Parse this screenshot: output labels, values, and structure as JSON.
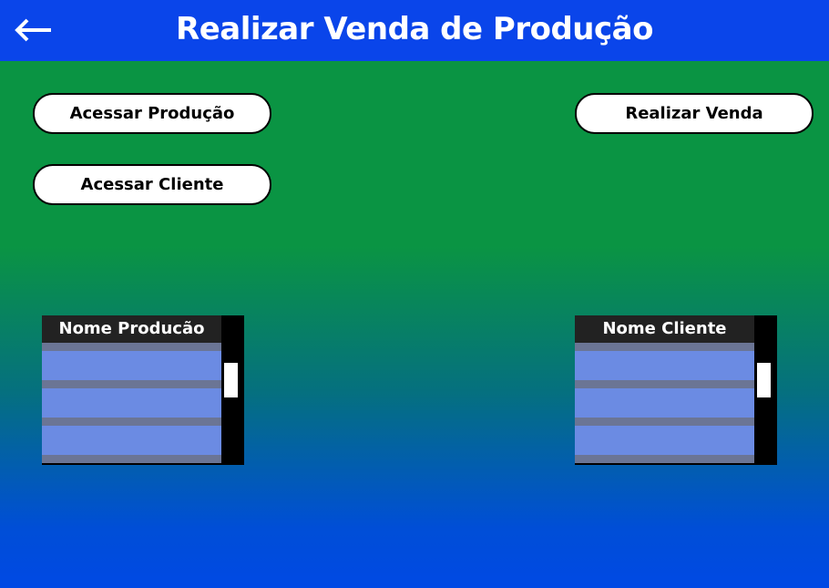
{
  "header": {
    "title": "Realizar Venda de Produção",
    "back_icon": "arrow-left-icon"
  },
  "buttons": {
    "acessar_producao": "Acessar Produção",
    "acessar_cliente": "Acessar Cliente",
    "realizar_venda": "Realizar Venda"
  },
  "lists": {
    "producao": {
      "header": "Nome Producão",
      "rows": [
        "",
        "",
        ""
      ]
    },
    "cliente": {
      "header": "Nome Cliente",
      "rows": [
        "",
        "",
        ""
      ]
    }
  },
  "colors": {
    "header_blue": "#0a45ea",
    "background_top_green": "#0a9443",
    "background_bottom_blue": "#0049e4",
    "list_row": "#6b8be3"
  }
}
